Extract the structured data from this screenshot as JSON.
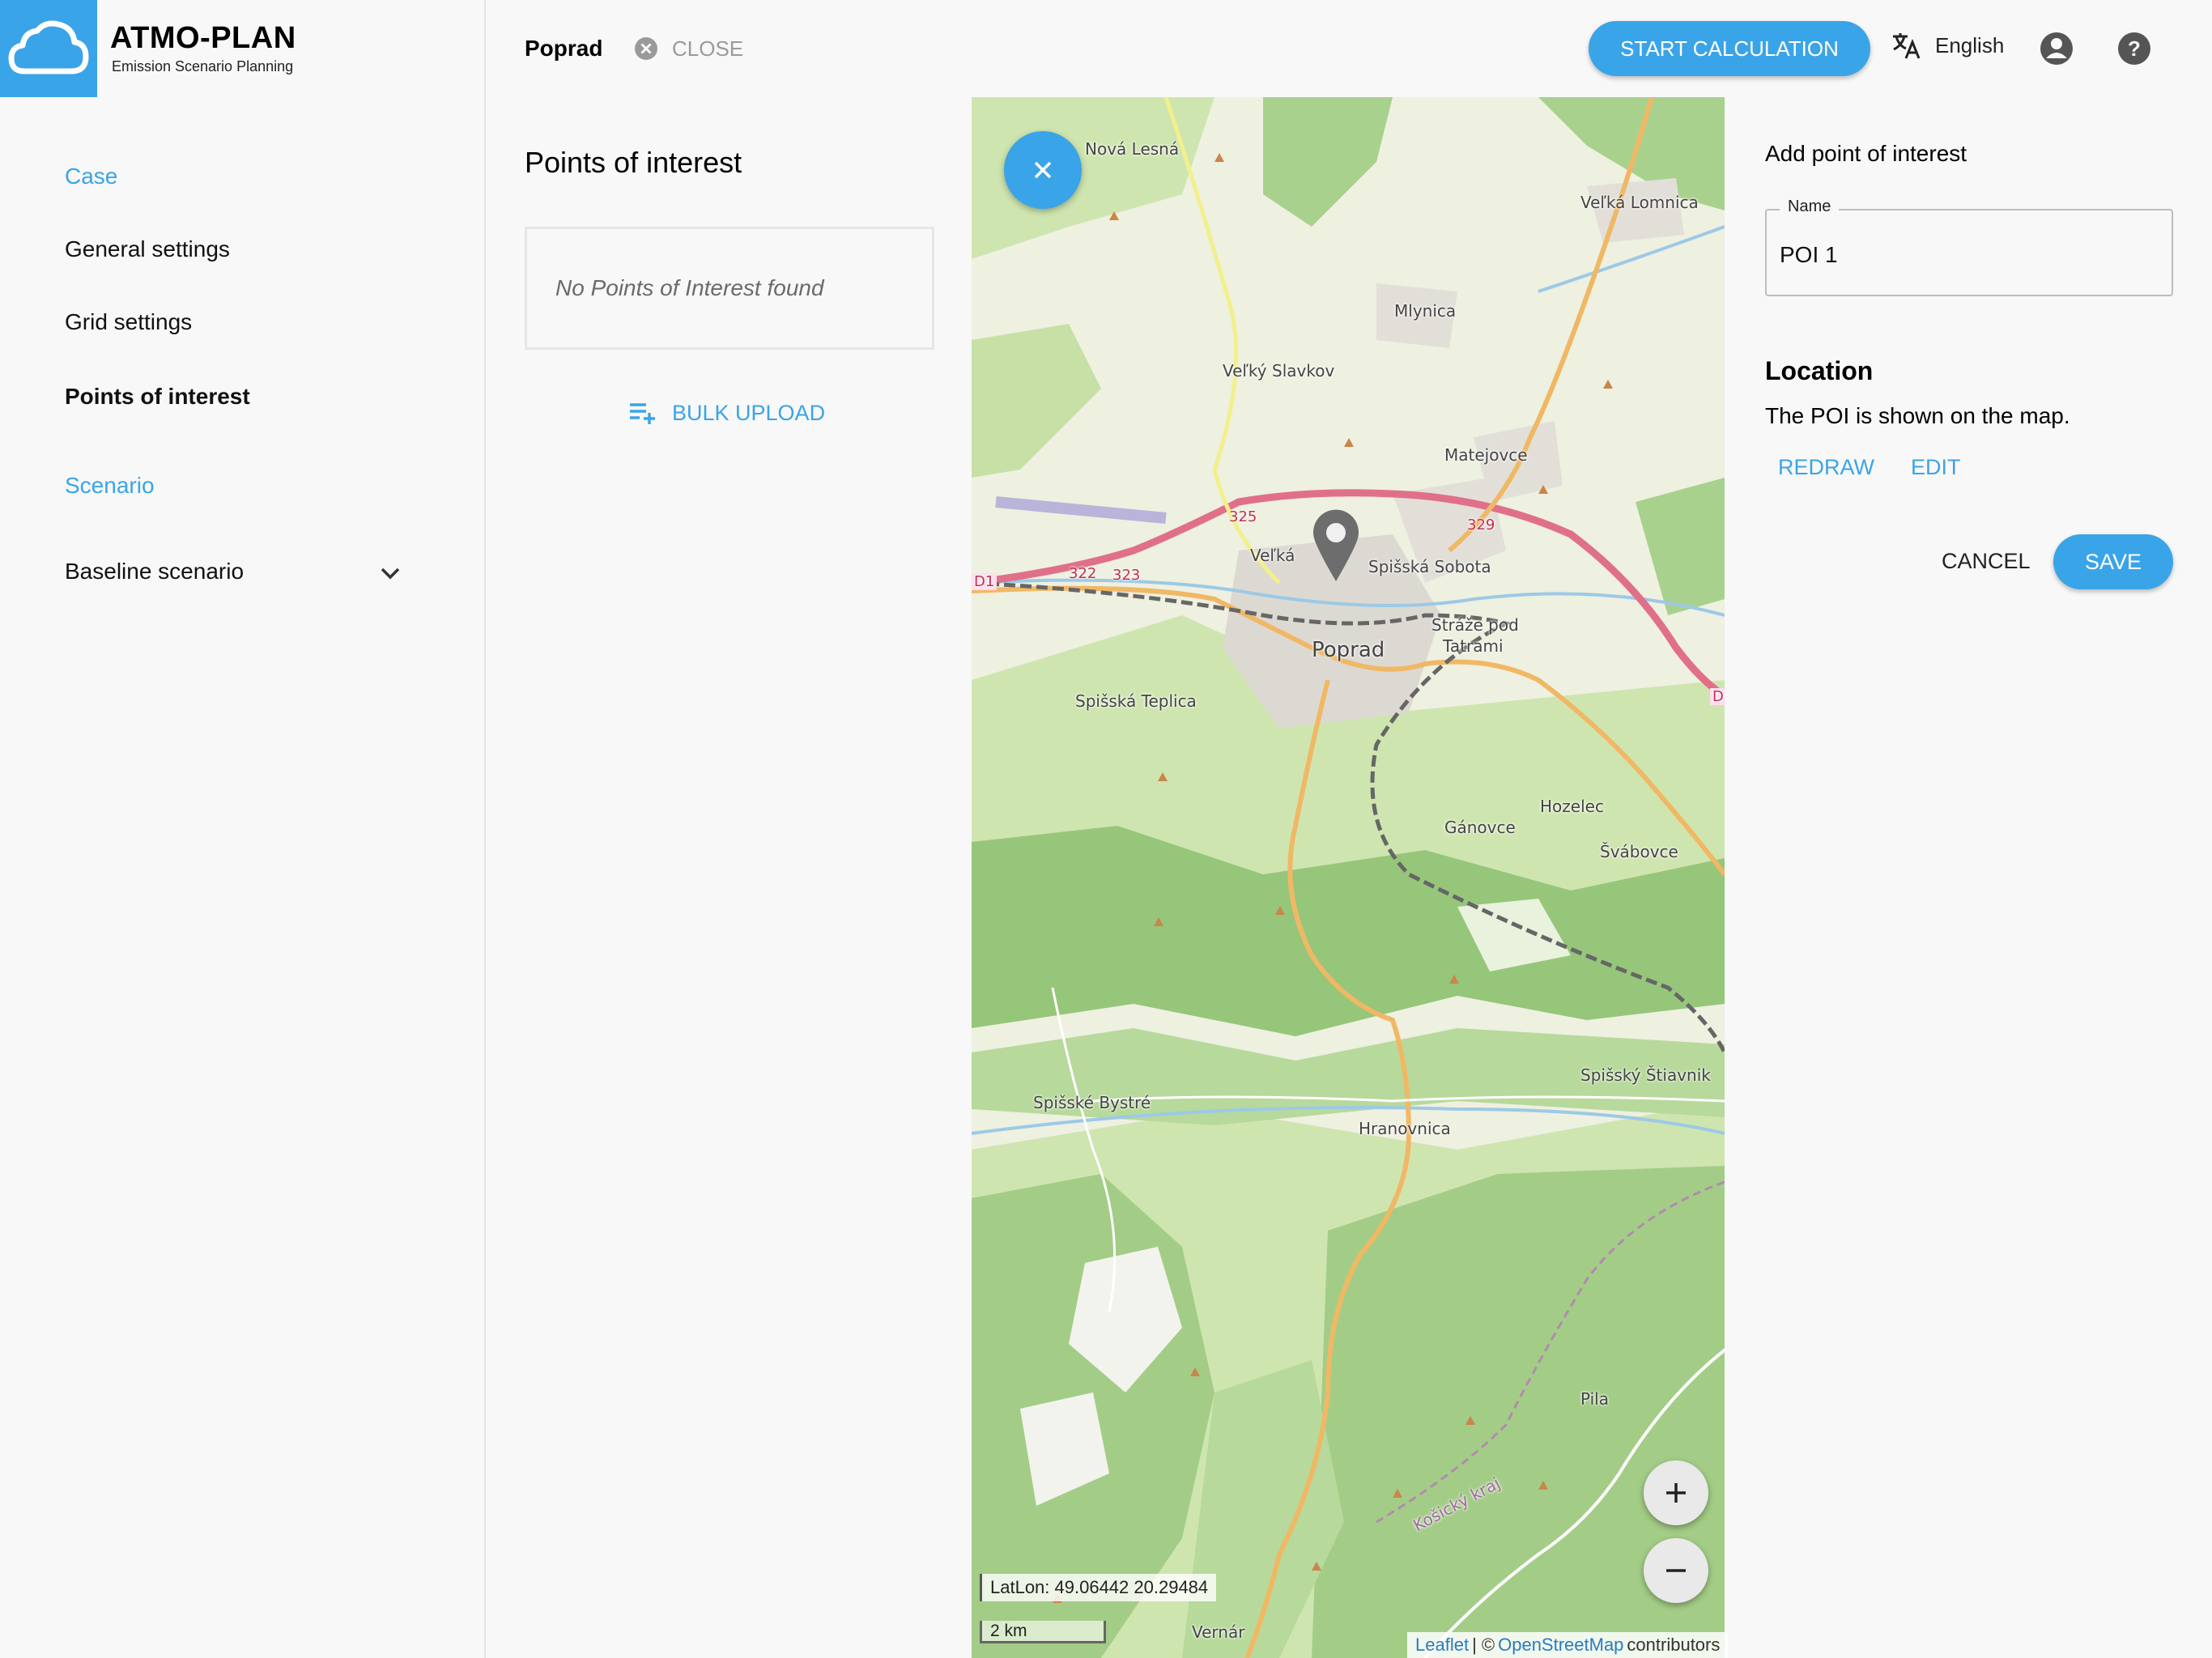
{
  "brand": {
    "title": "ATMO-PLAN",
    "subtitle": "Emission Scenario Planning"
  },
  "sidebar": {
    "items": [
      {
        "label": "Case",
        "type": "section"
      },
      {
        "label": "General settings",
        "type": "item"
      },
      {
        "label": "Grid settings",
        "type": "item"
      },
      {
        "label": "Points of interest",
        "type": "item",
        "active": true
      },
      {
        "label": "Scenario",
        "type": "section"
      },
      {
        "label": "Baseline scenario",
        "type": "dropdown"
      }
    ]
  },
  "header": {
    "case_name": "Poprad",
    "close_label": "CLOSE",
    "start_label": "START CALCULATION",
    "language": "English"
  },
  "poi_panel": {
    "title": "Points of interest",
    "empty_text": "No Points of Interest found",
    "bulk_upload_label": "BULK UPLOAD"
  },
  "map": {
    "latlon": "LatLon: 49.06442 20.29484",
    "scale": "2 km",
    "attribution_leaflet": "Leaflet",
    "attribution_sep": " | ©",
    "attribution_osm": "OpenStreetMap",
    "attribution_contrib": "contributors",
    "places": [
      "Nová Lesná",
      "Veľká Lomnica",
      "Mlynica",
      "Veľký Slavkov",
      "Matejovce",
      "Veľká",
      "Spišská Sobota",
      "Stráže pod",
      "Tatrami",
      "Poprad",
      "Spišská Teplica",
      "Gánovce",
      "Hozelec",
      "Švábovce",
      "Spišské Bystré",
      "Hranovnica",
      "Spišský Štiavnik",
      "Pila",
      "Vernár",
      "Košický kraj"
    ],
    "road_numbers": [
      "325",
      "329",
      "322",
      "323",
      "D1",
      "D"
    ],
    "colors": {
      "forest": "#a9d18e",
      "meadow": "#c6e0a6",
      "base": "#eef0e0",
      "motorway": "#e0708a",
      "primary": "#f0b865",
      "rail": "#666666"
    }
  },
  "add_poi": {
    "title": "Add point of interest",
    "name_label": "Name",
    "name_value": "POI 1",
    "location_title": "Location",
    "location_text": "The POI is shown on the map.",
    "redraw_label": "REDRAW",
    "edit_label": "EDIT",
    "cancel_label": "CANCEL",
    "save_label": "SAVE"
  },
  "accent_color": "#3aa4e8"
}
